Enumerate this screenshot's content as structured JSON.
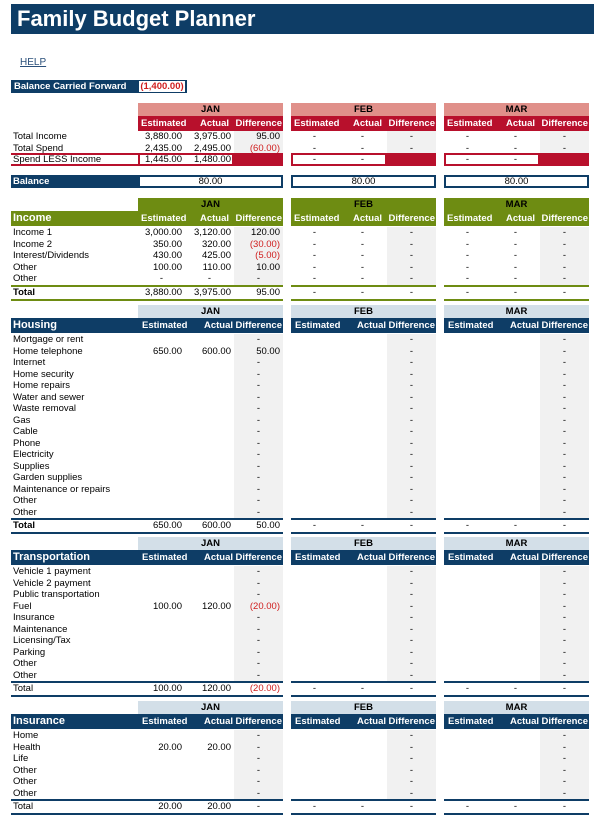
{
  "title": "Family Budget Planner",
  "help_link": "HELP",
  "balance_carried_forward": {
    "label": "Balance Carried Forward",
    "value": "(1,400.00)"
  },
  "months": [
    "JAN",
    "FEB",
    "MAR"
  ],
  "column_headers": {
    "estimated": "Estimated",
    "actual": "Actual",
    "difference": "Difference"
  },
  "colors": {
    "navy": "#0e3d66",
    "red": "#b8102c",
    "pink": "#e0908a",
    "green": "#6e8c12",
    "green_dark": "#547010",
    "light_blue": "#d3dfe8",
    "negative": "#d01e1e"
  },
  "summary": {
    "rows": [
      {
        "label": "Total Income",
        "values": [
          [
            "3,880.00",
            "3,975.00",
            "95.00"
          ],
          [
            "-",
            "-",
            "-"
          ],
          [
            "-",
            "-",
            "-"
          ]
        ]
      },
      {
        "label": "Total Spend",
        "values": [
          [
            "2,435.00",
            "2,495.00",
            "(60.00)"
          ],
          [
            "-",
            "-",
            "-"
          ],
          [
            "-",
            "-",
            "-"
          ]
        ]
      },
      {
        "label": "Spend LESS Income",
        "values": [
          [
            "1,445.00",
            "1,480.00",
            ""
          ],
          [
            "-",
            "-",
            ""
          ],
          [
            "-",
            "-",
            ""
          ]
        ]
      }
    ],
    "balance_label": "Balance",
    "balance_values": [
      "80.00",
      "80.00",
      "80.00"
    ]
  },
  "income": {
    "title": "Income",
    "rows": [
      {
        "label": "Income 1",
        "values": [
          [
            "3,000.00",
            "3,120.00",
            "120.00"
          ],
          [
            "-",
            "-",
            "-"
          ],
          [
            "-",
            "-",
            "-"
          ]
        ]
      },
      {
        "label": "Income 2",
        "values": [
          [
            "350.00",
            "320.00",
            "(30.00)"
          ],
          [
            "-",
            "-",
            "-"
          ],
          [
            "-",
            "-",
            "-"
          ]
        ]
      },
      {
        "label": "Interest/Dividends",
        "values": [
          [
            "430.00",
            "425.00",
            "(5.00)"
          ],
          [
            "-",
            "-",
            "-"
          ],
          [
            "-",
            "-",
            "-"
          ]
        ]
      },
      {
        "label": "Other",
        "values": [
          [
            "100.00",
            "110.00",
            "10.00"
          ],
          [
            "-",
            "-",
            "-"
          ],
          [
            "-",
            "-",
            "-"
          ]
        ]
      },
      {
        "label": "Other",
        "values": [
          [
            "-",
            "-",
            "-"
          ],
          [
            "-",
            "-",
            "-"
          ],
          [
            "-",
            "-",
            "-"
          ]
        ]
      }
    ],
    "total": {
      "label": "Total",
      "values": [
        [
          "3,880.00",
          "3,975.00",
          "95.00"
        ],
        [
          "-",
          "-",
          "-"
        ],
        [
          "-",
          "-",
          "-"
        ]
      ]
    }
  },
  "housing": {
    "title": "Housing",
    "rows": [
      {
        "label": "Mortgage or rent",
        "values": [
          [
            "",
            "",
            "-"
          ],
          [
            "",
            "",
            "-"
          ],
          [
            "",
            "",
            "-"
          ]
        ]
      },
      {
        "label": "Home telephone",
        "values": [
          [
            "650.00",
            "600.00",
            "50.00"
          ],
          [
            "",
            "",
            "-"
          ],
          [
            "",
            "",
            "-"
          ]
        ]
      },
      {
        "label": "Internet",
        "values": [
          [
            "",
            "",
            "-"
          ],
          [
            "",
            "",
            "-"
          ],
          [
            "",
            "",
            "-"
          ]
        ]
      },
      {
        "label": "Home security",
        "values": [
          [
            "",
            "",
            "-"
          ],
          [
            "",
            "",
            "-"
          ],
          [
            "",
            "",
            "-"
          ]
        ]
      },
      {
        "label": "Home repairs",
        "values": [
          [
            "",
            "",
            "-"
          ],
          [
            "",
            "",
            "-"
          ],
          [
            "",
            "",
            "-"
          ]
        ]
      },
      {
        "label": "Water and sewer",
        "values": [
          [
            "",
            "",
            "-"
          ],
          [
            "",
            "",
            "-"
          ],
          [
            "",
            "",
            "-"
          ]
        ]
      },
      {
        "label": "Waste removal",
        "values": [
          [
            "",
            "",
            "-"
          ],
          [
            "",
            "",
            "-"
          ],
          [
            "",
            "",
            "-"
          ]
        ]
      },
      {
        "label": "Gas",
        "values": [
          [
            "",
            "",
            "-"
          ],
          [
            "",
            "",
            "-"
          ],
          [
            "",
            "",
            "-"
          ]
        ]
      },
      {
        "label": "Cable",
        "values": [
          [
            "",
            "",
            "-"
          ],
          [
            "",
            "",
            "-"
          ],
          [
            "",
            "",
            "-"
          ]
        ]
      },
      {
        "label": "Phone",
        "values": [
          [
            "",
            "",
            "-"
          ],
          [
            "",
            "",
            "-"
          ],
          [
            "",
            "",
            "-"
          ]
        ]
      },
      {
        "label": "Electricity",
        "values": [
          [
            "",
            "",
            "-"
          ],
          [
            "",
            "",
            "-"
          ],
          [
            "",
            "",
            "-"
          ]
        ]
      },
      {
        "label": "Supplies",
        "values": [
          [
            "",
            "",
            "-"
          ],
          [
            "",
            "",
            "-"
          ],
          [
            "",
            "",
            "-"
          ]
        ]
      },
      {
        "label": "Garden supplies",
        "values": [
          [
            "",
            "",
            "-"
          ],
          [
            "",
            "",
            "-"
          ],
          [
            "",
            "",
            "-"
          ]
        ]
      },
      {
        "label": "Maintenance or repairs",
        "values": [
          [
            "",
            "",
            "-"
          ],
          [
            "",
            "",
            "-"
          ],
          [
            "",
            "",
            "-"
          ]
        ]
      },
      {
        "label": "Other",
        "values": [
          [
            "",
            "",
            "-"
          ],
          [
            "",
            "",
            "-"
          ],
          [
            "",
            "",
            "-"
          ]
        ]
      },
      {
        "label": "Other",
        "values": [
          [
            "",
            "",
            "-"
          ],
          [
            "",
            "",
            "-"
          ],
          [
            "",
            "",
            "-"
          ]
        ]
      }
    ],
    "total": {
      "label": "Total",
      "values": [
        [
          "650.00",
          "600.00",
          "50.00"
        ],
        [
          "-",
          "-",
          "-"
        ],
        [
          "-",
          "-",
          "-"
        ]
      ]
    }
  },
  "transportation": {
    "title": "Transportation",
    "rows": [
      {
        "label": "Vehicle 1 payment",
        "values": [
          [
            "",
            "",
            "-"
          ],
          [
            "",
            "",
            "-"
          ],
          [
            "",
            "",
            "-"
          ]
        ]
      },
      {
        "label": "Vehicle 2 payment",
        "values": [
          [
            "",
            "",
            "-"
          ],
          [
            "",
            "",
            "-"
          ],
          [
            "",
            "",
            "-"
          ]
        ]
      },
      {
        "label": "Public transportation",
        "values": [
          [
            "",
            "",
            "-"
          ],
          [
            "",
            "",
            "-"
          ],
          [
            "",
            "",
            "-"
          ]
        ]
      },
      {
        "label": "Fuel",
        "values": [
          [
            "100.00",
            "120.00",
            "(20.00)"
          ],
          [
            "",
            "",
            "-"
          ],
          [
            "",
            "",
            "-"
          ]
        ]
      },
      {
        "label": "Insurance",
        "values": [
          [
            "",
            "",
            "-"
          ],
          [
            "",
            "",
            "-"
          ],
          [
            "",
            "",
            "-"
          ]
        ]
      },
      {
        "label": "Maintenance",
        "values": [
          [
            "",
            "",
            "-"
          ],
          [
            "",
            "",
            "-"
          ],
          [
            "",
            "",
            "-"
          ]
        ]
      },
      {
        "label": "Licensing/Tax",
        "values": [
          [
            "",
            "",
            "-"
          ],
          [
            "",
            "",
            "-"
          ],
          [
            "",
            "",
            "-"
          ]
        ]
      },
      {
        "label": "Parking",
        "values": [
          [
            "",
            "",
            "-"
          ],
          [
            "",
            "",
            "-"
          ],
          [
            "",
            "",
            "-"
          ]
        ]
      },
      {
        "label": "Other",
        "values": [
          [
            "",
            "",
            "-"
          ],
          [
            "",
            "",
            "-"
          ],
          [
            "",
            "",
            "-"
          ]
        ]
      },
      {
        "label": "Other",
        "values": [
          [
            "",
            "",
            "-"
          ],
          [
            "",
            "",
            "-"
          ],
          [
            "",
            "",
            "-"
          ]
        ]
      }
    ],
    "total": {
      "label": "Total",
      "values": [
        [
          "100.00",
          "120.00",
          "(20.00)"
        ],
        [
          "-",
          "-",
          "-"
        ],
        [
          "-",
          "-",
          "-"
        ]
      ]
    }
  },
  "insurance": {
    "title": "Insurance",
    "rows": [
      {
        "label": "Home",
        "values": [
          [
            "",
            "",
            "-"
          ],
          [
            "",
            "",
            "-"
          ],
          [
            "",
            "",
            "-"
          ]
        ]
      },
      {
        "label": "Health",
        "values": [
          [
            "20.00",
            "20.00",
            "-"
          ],
          [
            "",
            "",
            "-"
          ],
          [
            "",
            "",
            "-"
          ]
        ]
      },
      {
        "label": "Life",
        "values": [
          [
            "",
            "",
            "-"
          ],
          [
            "",
            "",
            "-"
          ],
          [
            "",
            "",
            "-"
          ]
        ]
      },
      {
        "label": "Other",
        "values": [
          [
            "",
            "",
            "-"
          ],
          [
            "",
            "",
            "-"
          ],
          [
            "",
            "",
            "-"
          ]
        ]
      },
      {
        "label": "Other",
        "values": [
          [
            "",
            "",
            "-"
          ],
          [
            "",
            "",
            "-"
          ],
          [
            "",
            "",
            "-"
          ]
        ]
      },
      {
        "label": "Other",
        "values": [
          [
            "",
            "",
            "-"
          ],
          [
            "",
            "",
            "-"
          ],
          [
            "",
            "",
            "-"
          ]
        ]
      }
    ],
    "total": {
      "label": "Total",
      "values": [
        [
          "20.00",
          "20.00",
          "-"
        ],
        [
          "-",
          "-",
          "-"
        ],
        [
          "-",
          "-",
          "-"
        ]
      ]
    }
  }
}
